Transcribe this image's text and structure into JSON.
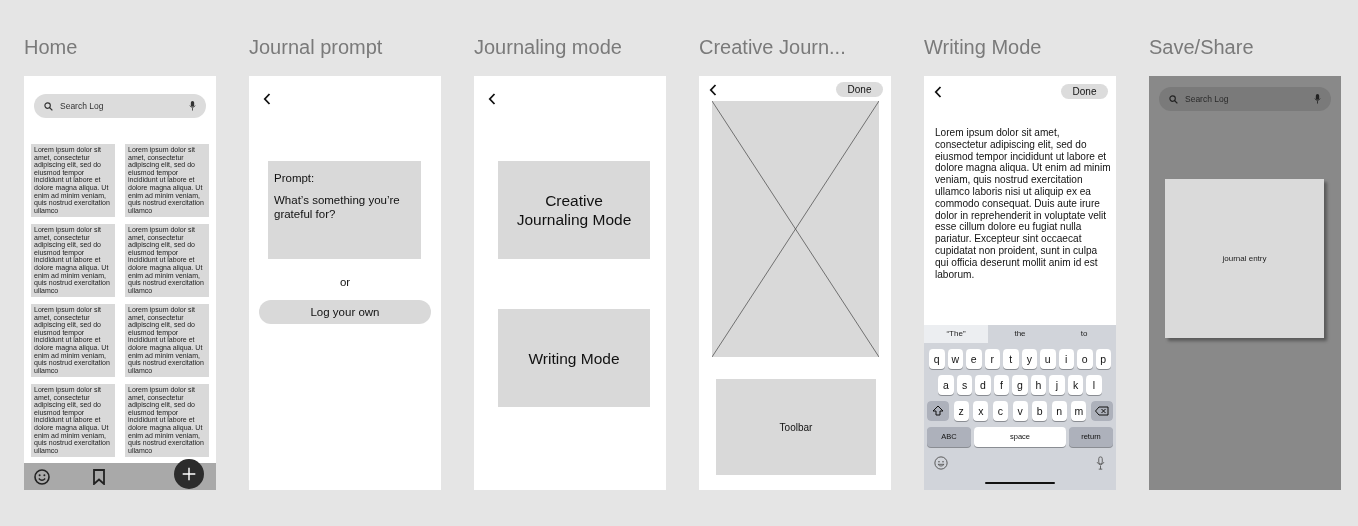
{
  "frames": [
    {
      "kind": "home",
      "title": "Home",
      "search": {
        "placeholder": "Search Log"
      },
      "entries": [
        "Lorem ipsum dolor sit amet, consectetur adipiscing elit, sed do eiusmod tempor incididunt ut labore et dolore magna aliqua. Ut enim ad minim veniam, quis nostrud exercitation ullamco",
        "Lorem ipsum dolor sit amet, consectetur adipiscing elit, sed do eiusmod tempor incididunt ut labore et dolore magna aliqua. Ut enim ad minim veniam, quis nostrud exercitation ullamco",
        "Lorem ipsum dolor sit amet, consectetur adipiscing elit, sed do eiusmod tempor incididunt ut labore et dolore magna aliqua. Ut enim ad minim veniam, quis nostrud exercitation ullamco",
        "Lorem ipsum dolor sit amet, consectetur adipiscing elit, sed do eiusmod tempor incididunt ut labore et dolore magna aliqua. Ut enim ad minim veniam, quis nostrud exercitation ullamco",
        "Lorem ipsum dolor sit amet, consectetur adipiscing elit, sed do eiusmod tempor incididunt ut labore et dolore magna aliqua. Ut enim ad minim veniam, quis nostrud exercitation ullamco",
        "Lorem ipsum dolor sit amet, consectetur adipiscing elit, sed do eiusmod tempor incididunt ut labore et dolore magna aliqua. Ut enim ad minim veniam, quis nostrud exercitation ullamco",
        "Lorem ipsum dolor sit amet, consectetur adipiscing elit, sed do eiusmod tempor incididunt ut labore et dolore magna aliqua. Ut enim ad minim veniam, quis nostrud exercitation ullamco",
        "Lorem ipsum dolor sit amet, consectetur adipiscing elit, sed do eiusmod tempor incididunt ut labore et dolore magna aliqua. Ut enim ad minim veniam, quis nostrud exercitation ullamco"
      ]
    },
    {
      "kind": "prompt",
      "title": "Journal prompt",
      "prompt_label": "Prompt:",
      "prompt_text": "What’s something you’re grateful for?",
      "separator": "or",
      "button": "Log your own"
    },
    {
      "kind": "modes",
      "title": "Journaling mode",
      "options": [
        "Creative Journaling Mode",
        "Writing Mode"
      ]
    },
    {
      "kind": "creative",
      "title": "Creative Journ...",
      "done": "Done",
      "toolbar": "Toolbar"
    },
    {
      "kind": "writing",
      "title": "Writing Mode",
      "done": "Done",
      "body": "Lorem ipsum dolor sit amet, consectetur adipiscing elit, sed do eiusmod tempor incididunt ut labore et dolore magna aliqua. Ut enim ad minim veniam, quis nostrud exercitation ullamco laboris nisi ut aliquip ex ea commodo consequat. Duis aute irure dolor in reprehenderit in voluptate velit esse cillum dolore eu fugiat nulla pariatur. Excepteur sint occaecat cupidatat non proident, sunt in culpa qui officia deserunt mollit anim id est laborum.",
      "keyboard": {
        "suggestions": [
          {
            "label": "“The”",
            "selected": true
          },
          {
            "label": "the",
            "selected": false
          },
          {
            "label": "to",
            "selected": false
          }
        ],
        "rows": [
          [
            "q",
            "w",
            "e",
            "r",
            "t",
            "y",
            "u",
            "i",
            "o",
            "p"
          ],
          [
            "a",
            "s",
            "d",
            "f",
            "g",
            "h",
            "j",
            "k",
            "l"
          ],
          [
            "z",
            "x",
            "c",
            "v",
            "b",
            "n",
            "m"
          ]
        ],
        "bottom": [
          "ABC",
          "space",
          "return"
        ]
      }
    },
    {
      "kind": "share",
      "title": "Save/Share",
      "search": {
        "placeholder": "Search Log"
      },
      "entry": "journal entry"
    }
  ]
}
